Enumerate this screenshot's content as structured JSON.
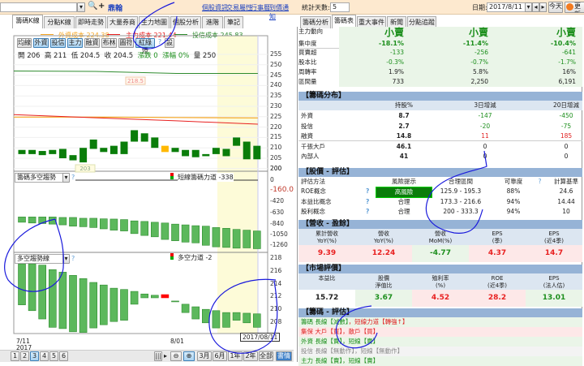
{
  "left_header": {
    "stock_name": "鼎翰",
    "links": [
      "個股資訊",
      "交易屬性",
      "行事曆",
      "到價通知"
    ]
  },
  "left_tabs": [
    "籌碼K線",
    "分點K線",
    "即時走勢",
    "大量券商",
    "主力地圖",
    "個股分析",
    "進階",
    "筆記"
  ],
  "legend": [
    {
      "label": "外資成本 224.38",
      "color": "#f5a623"
    },
    {
      "label": "主力成本 221.44",
      "color": "#e82020"
    },
    {
      "label": "投信成本 245.83",
      "color": "#2e8b2e"
    }
  ],
  "toolbar_buttons": [
    {
      "label": "均線",
      "on": false
    },
    {
      "label": "外資",
      "on": true
    },
    {
      "label": "投信",
      "on": true
    },
    {
      "label": "主力",
      "on": true
    },
    {
      "label": "融資",
      "on": false
    },
    {
      "label": "布林",
      "on": false
    },
    {
      "label": "圖符",
      "on": false
    },
    {
      "label": "紅綠燈",
      "on": true
    },
    {
      "label": "?",
      "on": false
    },
    {
      "label": "設",
      "on": false
    }
  ],
  "ohlc": {
    "open": "開 206",
    "high": "高 211",
    "low": "低 204.5",
    "close": "收 204.5",
    "change": "漲跌 0",
    "pct": "漲幅 0%",
    "volume": "量 250"
  },
  "chart_data": [
    {
      "type": "candlestick",
      "name": "price",
      "axis_ticks": [
        255,
        250,
        245,
        240,
        235,
        230,
        225,
        220,
        215,
        210,
        205,
        200
      ],
      "candles": [
        [
          207,
          209
        ],
        [
          207,
          209
        ],
        [
          206.5,
          208.5
        ],
        [
          207,
          209
        ],
        [
          205,
          209.5
        ],
        [
          204,
          206.5
        ],
        [
          203,
          210
        ],
        [
          209.5,
          214
        ],
        [
          208,
          210
        ],
        [
          207,
          211
        ],
        [
          207,
          213
        ],
        [
          213,
          218.5
        ],
        [
          213,
          217
        ],
        [
          210,
          215
        ],
        [
          208,
          211
        ],
        [
          208,
          210
        ],
        [
          206,
          209
        ],
        [
          205.5,
          209
        ],
        [
          206,
          207
        ],
        [
          207,
          210
        ],
        [
          206,
          209.5
        ],
        [
          211,
          215
        ],
        [
          204.5,
          213
        ],
        [
          204.5,
          211
        ]
      ],
      "flat_index": 14,
      "ma": {
        "foreign": [
          224.8,
          224.8,
          224.6,
          224.4
        ],
        "main": [
          226,
          224.5,
          223,
          221.4
        ],
        "trust": [
          247,
          246.8,
          245.8,
          245.8
        ]
      },
      "annotations": [
        "218.5",
        "203"
      ]
    },
    {
      "type": "bar",
      "name": "籌碼多空趨勢",
      "selector": "籌碼多空趨勢",
      "legend": "短線籌碼力道 -338",
      "axis_ticks": [
        "200",
        "0",
        "-160.0",
        "-420",
        "-630",
        "-840",
        "-1050",
        "-1260"
      ],
      "bars": [
        [
          -730,
          -835
        ],
        [
          -730,
          -850
        ],
        [
          -730,
          -861
        ],
        [
          -730,
          -872
        ],
        [
          -740,
          -887
        ],
        [
          -740,
          -913
        ],
        [
          -756,
          -924
        ],
        [
          -756,
          -940
        ],
        [
          -767,
          -966
        ],
        [
          -772,
          -992
        ],
        [
          -782,
          -1008
        ],
        [
          -808,
          -1060
        ],
        [
          -819,
          -1097
        ],
        [
          -835,
          -1124
        ],
        [
          -850,
          -1176
        ],
        [
          -872,
          -1202
        ],
        [
          -887,
          -1229
        ],
        [
          -903,
          -1244
        ],
        [
          -913,
          -1292
        ],
        [
          -940,
          -1323
        ],
        [
          -955,
          -1334
        ],
        [
          -977,
          -1349
        ],
        [
          -992,
          -1344
        ],
        [
          -1008,
          -1360
        ]
      ]
    },
    {
      "type": "bar",
      "name": "多空趨勢線",
      "selector": "多空趨勢線",
      "legend": "多空力道 -2",
      "axis_ticks": [
        "218",
        "216",
        "214",
        "212",
        "210",
        "208"
      ],
      "bars": [
        [
          217.1,
          210.7
        ],
        [
          217.1,
          209.8
        ],
        [
          216.9,
          208.5
        ],
        [
          216.2,
          207.2
        ],
        [
          215.8,
          207.0
        ],
        [
          215.3,
          206.5
        ],
        [
          214.8,
          206.4
        ],
        [
          214.2,
          207.1
        ],
        [
          213.8,
          207.6
        ],
        [
          213.3,
          208.1
        ],
        [
          213.1,
          208.3
        ],
        [
          212.8,
          210.8
        ],
        [
          212.4,
          211.8
        ],
        [
          212.2,
          211.8
        ],
        [
          212.3,
          211.8
        ],
        [
          211.3,
          211.2
        ],
        [
          210.8,
          209.5
        ],
        [
          210.4,
          208.5
        ],
        [
          210.0,
          207.9
        ],
        [
          209.8,
          207.1
        ],
        [
          209.5,
          207.2
        ],
        [
          209.5,
          208.3
        ],
        [
          209.4,
          207.9
        ],
        [
          209.3,
          207.2
        ]
      ],
      "red_index": 14
    }
  ],
  "x_labels": {
    "start": "7/11",
    "year": "2017",
    "mid": "8/01",
    "cursor": "2017/08/11"
  },
  "bottom_bar": {
    "pages": [
      "1",
      "2",
      "3",
      "4",
      "5",
      "6"
    ],
    "active_page": "3",
    "ranges": [
      "3月",
      "6月",
      "1年",
      "2年",
      "全部"
    ],
    "last": "書情"
  },
  "right_header": {
    "days_label": "統計天數:",
    "days_value": "5",
    "date_label": "日期:",
    "date_value": "2017/8/11",
    "today": "今天",
    "refresh": "更新"
  },
  "right_tabs": [
    "籌碼分析",
    "籌碼表",
    "重大事件",
    "新聞",
    "分點追蹤"
  ],
  "summary": {
    "rows": [
      {
        "label": "主力動向",
        "values": [
          "小賣",
          "小賣",
          "小賣"
        ]
      },
      {
        "label": "集中度",
        "values": [
          "-18.1%",
          "-11.4%",
          "-10.4%"
        ]
      },
      {
        "label": "買賣超",
        "values": [
          "-133",
          "-256",
          "-641"
        ]
      },
      {
        "label": "股本比",
        "values": [
          "-0.3%",
          "-0.7%",
          "-1.7%"
        ]
      },
      {
        "label": "周轉率",
        "values": [
          "1.9%",
          "5.8%",
          "16%"
        ]
      },
      {
        "label": "區間量",
        "values": [
          "733",
          "2,250",
          "6,191"
        ]
      }
    ]
  },
  "distribution": {
    "title": "【籌碼分布】",
    "headers": [
      "持股%",
      "3日增減",
      "20日增減"
    ],
    "rows": [
      {
        "label": "外資",
        "v": [
          "8.7",
          "-147",
          "-450"
        ]
      },
      {
        "label": "投信",
        "v": [
          "2.7",
          "-20",
          "-75"
        ]
      },
      {
        "label": "融資",
        "v": [
          "14.8",
          "11",
          "185"
        ]
      },
      {
        "label": "千張大戶",
        "v": [
          "46.1",
          "0",
          "0"
        ]
      },
      {
        "label": "內部人",
        "v": [
          "41",
          "0",
          "0"
        ]
      }
    ]
  },
  "valuation": {
    "title": "【股價 - 評估】",
    "headers": [
      "評估方法",
      "風險提示",
      "合理區間",
      "可靠度",
      "?",
      "計算基準"
    ],
    "rows": [
      {
        "label": "ROE概念",
        "risk": "高風險",
        "range": "125.9 - 195.3",
        "rel": "88%",
        "base": "24.6"
      },
      {
        "label": "本益比概念",
        "risk": "合理",
        "range": "173.3 - 216.6",
        "rel": "94%",
        "base": "14.44"
      },
      {
        "label": "股利概念",
        "risk": "合理",
        "range": "200 - 333.3",
        "rel": "94%",
        "base": "10"
      }
    ]
  },
  "revenue": {
    "title": "【營收 - 盈餘】",
    "headers": [
      [
        "累計營收",
        "YoY(%)"
      ],
      [
        "營收",
        "YoY(%)"
      ],
      [
        "營收",
        "MoM(%)"
      ],
      [
        "EPS",
        "(季)"
      ],
      [
        "EPS",
        "(近4季)"
      ]
    ],
    "values": [
      "9.39",
      "12.24",
      "-4.77",
      "4.37",
      "14.7"
    ]
  },
  "market": {
    "title": "【市場評價】",
    "headers": [
      [
        "本益比",
        ""
      ],
      [
        "股價",
        "淨值比"
      ],
      [
        "殖利率",
        "(%)"
      ],
      [
        "ROE",
        "(近4季)"
      ],
      [
        "EPS",
        "(法人估)"
      ]
    ],
    "values": [
      "15.72",
      "3.67",
      "4.52",
      "28.2",
      "13.01"
    ]
  },
  "chip_eval": {
    "title": "【籌碼 - 評估】",
    "lines": [
      {
        "a": "籌碼 長線【減數】",
        "b": "，短線力道【轉強↑】",
        "ca": "g",
        "cb": "red",
        "bg": "#eaf5e8"
      },
      {
        "a": "集保 大戶【買】",
        "b": "，散戶【買】",
        "ca": "red",
        "cb": "red",
        "bg": "#fde8e8"
      },
      {
        "a": "外資 長線【賣】",
        "b": "，短線【賣】",
        "ca": "g",
        "cb": "g",
        "bg": "#eaf5e8"
      },
      {
        "a": "投信 長線【無動作】",
        "b": "，短線【無動作】",
        "ca": "gray",
        "cb": "gray",
        "bg": "#f3f3f3"
      },
      {
        "a": "主力 長線【賣】",
        "b": "，短線【賣】",
        "ca": "g",
        "cb": "g",
        "bg": "#eaf5e8"
      }
    ]
  }
}
